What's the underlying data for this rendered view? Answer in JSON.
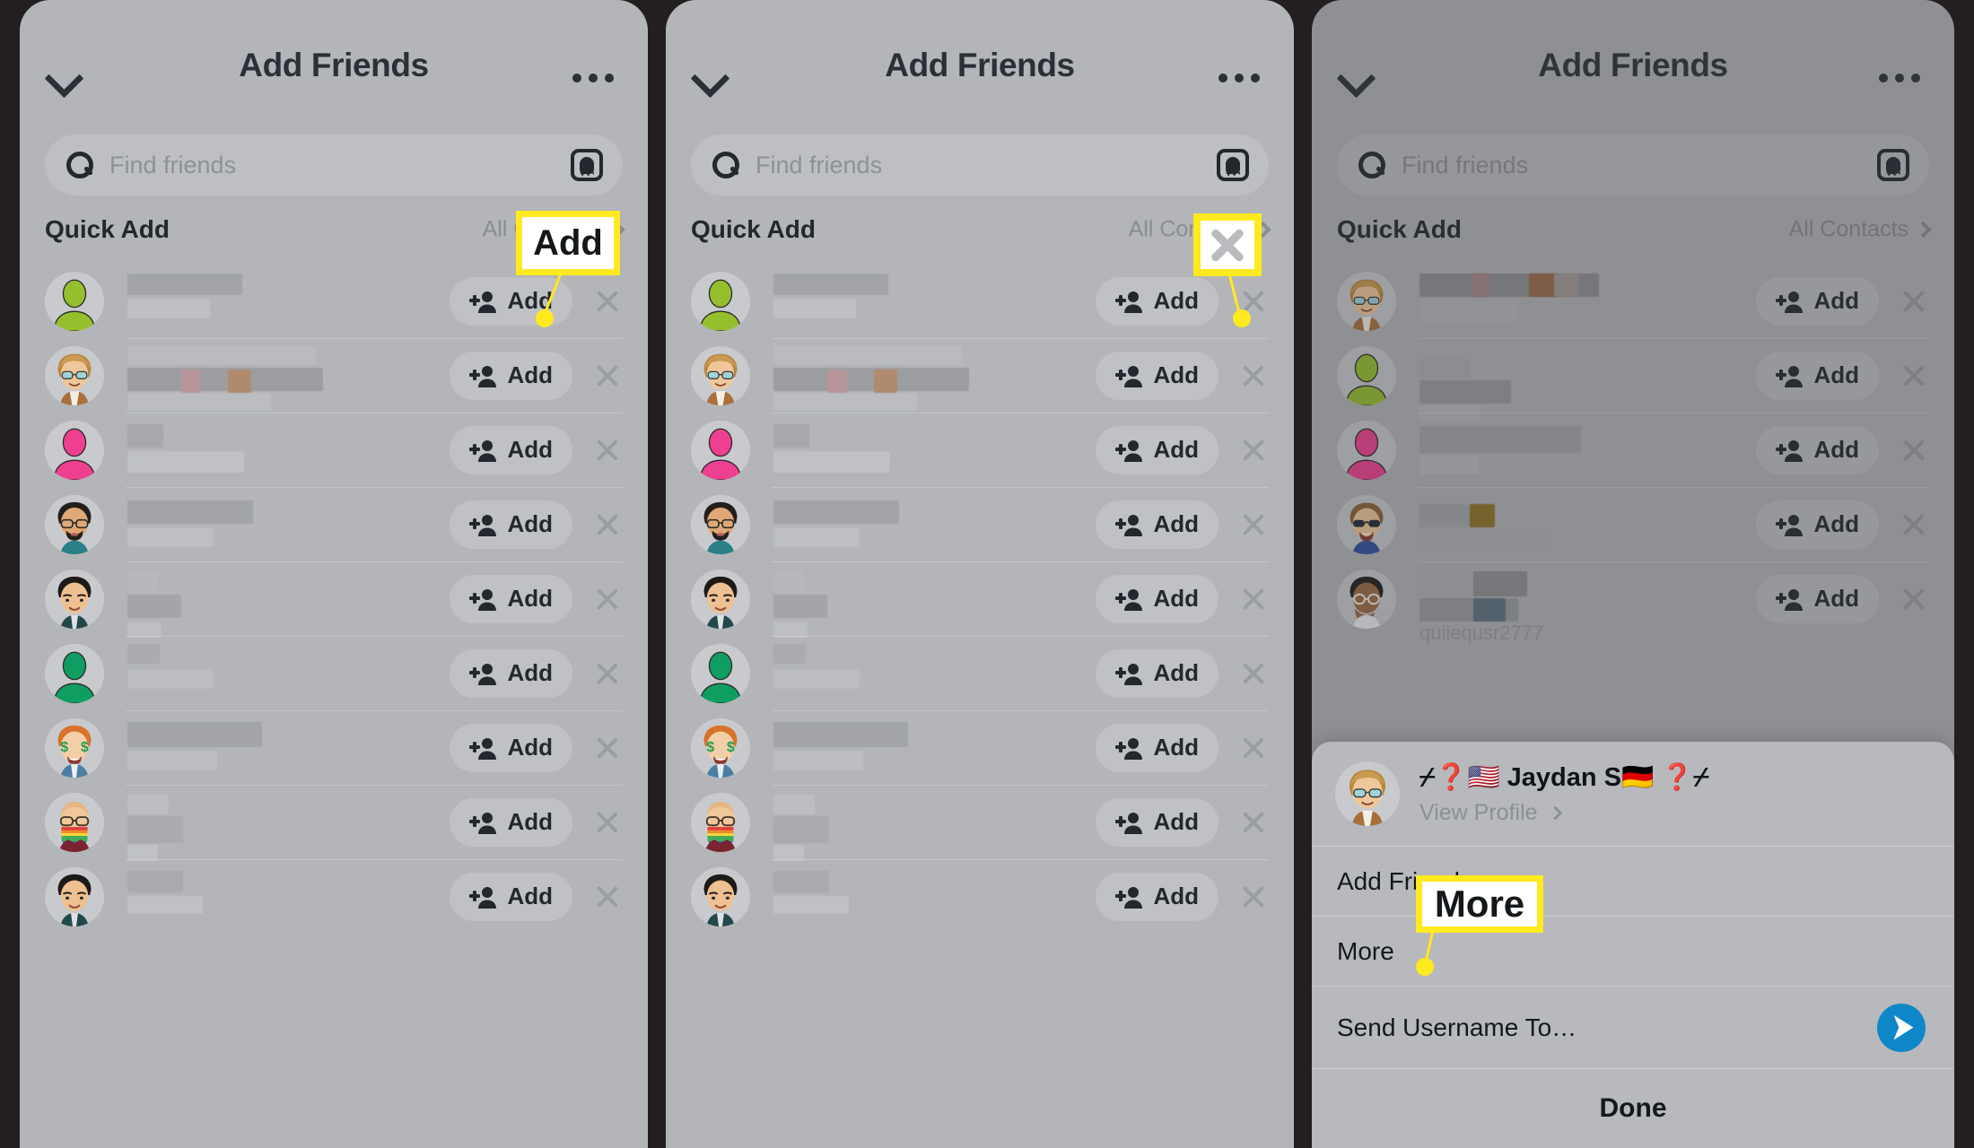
{
  "header": {
    "title": "Add Friends",
    "back_icon": "chevron-down-icon",
    "menu_icon": "ellipsis-icon"
  },
  "search": {
    "placeholder": "Find friends",
    "icon": "search-icon",
    "trailing_icon": "snapchat-ghost-icon"
  },
  "quick_add": {
    "title": "Quick Add",
    "all_contacts_label": "All Contacts",
    "caret_icon": "chevron-right-icon"
  },
  "row_defaults": {
    "add_label": "Add",
    "add_icon": "add-person-icon",
    "dismiss_icon": "close-icon"
  },
  "panels": [
    {
      "id": "panel-1",
      "rows": [
        {
          "avatar": "generic-green",
          "add_label": "Add"
        },
        {
          "avatar": "bitmoji-blond-glasses",
          "add_label": "Add"
        },
        {
          "avatar": "generic-pink",
          "add_label": "Add"
        },
        {
          "avatar": "bitmoji-beard-glasses",
          "add_label": "Add"
        },
        {
          "avatar": "bitmoji-dark-hair",
          "add_label": "Add"
        },
        {
          "avatar": "generic-teal",
          "add_label": "Add"
        },
        {
          "avatar": "bitmoji-money-eyes",
          "add_label": "Add"
        },
        {
          "avatar": "bitmoji-rainbow-mask",
          "add_label": "Add"
        },
        {
          "avatar": "bitmoji-dark-hair",
          "add_label": "Add"
        }
      ]
    },
    {
      "id": "panel-2",
      "rows": [
        {
          "avatar": "generic-green",
          "add_label": "Add"
        },
        {
          "avatar": "bitmoji-blond-glasses",
          "add_label": "Add"
        },
        {
          "avatar": "generic-pink",
          "add_label": "Add"
        },
        {
          "avatar": "bitmoji-beard-glasses",
          "add_label": "Add"
        },
        {
          "avatar": "bitmoji-dark-hair",
          "add_label": "Add"
        },
        {
          "avatar": "generic-teal",
          "add_label": "Add"
        },
        {
          "avatar": "bitmoji-money-eyes",
          "add_label": "Add"
        },
        {
          "avatar": "bitmoji-rainbow-mask",
          "add_label": "Add"
        },
        {
          "avatar": "bitmoji-dark-hair",
          "add_label": "Add"
        }
      ]
    },
    {
      "id": "panel-3",
      "rows": [
        {
          "avatar": "bitmoji-blond-glasses",
          "add_label": "Add"
        },
        {
          "avatar": "generic-green",
          "add_label": "Add"
        },
        {
          "avatar": "generic-pink",
          "add_label": "Add"
        },
        {
          "avatar": "bitmoji-sunglasses",
          "add_label": "Add"
        },
        {
          "avatar": "bitmoji-hand-mouth",
          "add_label": "Add",
          "username_partial": "quiiequsr2777"
        }
      ]
    }
  ],
  "sheet": {
    "avatar": "bitmoji-blond-glasses",
    "name": "⌿❓🇺🇸 Jaydan S🇩🇪 ❓⌿",
    "view_profile_label": "View Profile",
    "view_profile_caret": "chevron-right-icon",
    "items": [
      {
        "label": "Add Friend",
        "name": "add-friend-row"
      },
      {
        "label": "More",
        "name": "more-row"
      },
      {
        "label": "Send Username To…",
        "name": "send-username-row",
        "trailing_icon": "send-arrow-icon"
      }
    ],
    "done_label": "Done"
  },
  "annotations": [
    {
      "id": "ann-add",
      "type": "text",
      "label": "Add",
      "target": "panel-1 add button"
    },
    {
      "id": "ann-x",
      "type": "icon",
      "label": "",
      "icon": "close-icon",
      "target": "panel-2 dismiss X"
    },
    {
      "id": "ann-more",
      "type": "text",
      "label": "More",
      "target": "panel-3 sheet More row"
    }
  ],
  "colors": {
    "panel_bg": "#b3b5b8",
    "outer_bg": "#231f20",
    "accent_highlight": "#ffe91f",
    "send_blue": "#0d87c8",
    "text_dark": "#23272e",
    "text_muted": "#8a8d91"
  }
}
